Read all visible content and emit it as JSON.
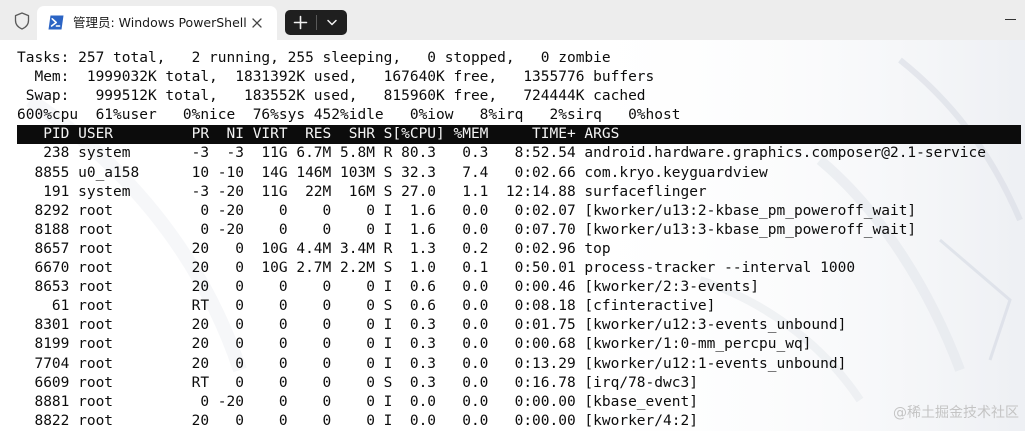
{
  "window": {
    "tab_title": "管理员: Windows PowerShell"
  },
  "icons": {
    "shield": "shield-icon",
    "powershell": "powershell-icon",
    "close": "close-icon",
    "new_tab": "plus-icon",
    "dropdown": "chevron-down-icon",
    "minimize": "minimize-icon"
  },
  "colors": {
    "titlebar_bg": "#ededed",
    "terminal_bg": "#ffffff",
    "terminal_fg": "#0c0c0c",
    "header_bg": "#0c0c0c",
    "header_fg": "#f4f4f4",
    "powershell_blue": "#2b64c4"
  },
  "terminal": {
    "summary": [
      "Tasks: 257 total,   2 running, 255 sleeping,   0 stopped,   0 zombie",
      "  Mem:  1999032K total,  1831392K used,   167640K free,   1355776 buffers",
      " Swap:   999512K total,   183552K used,   815960K free,   724444K cached",
      "600%cpu  61%user   0%nice  76%sys 452%idle   0%iow   8%irq   2%sirq   0%host"
    ],
    "header": "   PID USER         PR  NI VIRT  RES  SHR S[%CPU] %MEM     TIME+ ARGS",
    "processes": [
      "   238 system       -3  -3  11G 6.7M 5.8M R 80.3   0.3   8:52.54 android.hardware.graphics.composer@2.1-service",
      "  8855 u0_a158      10 -10  14G 146M 103M S 32.3   7.4   0:02.66 com.kryo.keyguardview",
      "   191 system       -3 -20  11G  22M  16M S 27.0   1.1  12:14.88 surfaceflinger",
      "  8292 root          0 -20    0    0    0 I  1.6   0.0   0:02.07 [kworker/u13:2-kbase_pm_poweroff_wait]",
      "  8188 root          0 -20    0    0    0 I  1.6   0.0   0:07.70 [kworker/u13:3-kbase_pm_poweroff_wait]",
      "  8657 root         20   0  10G 4.4M 3.4M R  1.3   0.2   0:02.96 top",
      "  6670 root         20   0  10G 2.7M 2.2M S  1.0   0.1   0:50.01 process-tracker --interval 1000",
      "  8653 root         20   0    0    0    0 I  0.6   0.0   0:00.46 [kworker/2:3-events]",
      "    61 root         RT   0    0    0    0 S  0.6   0.0   0:08.18 [cfinteractive]",
      "  8301 root         20   0    0    0    0 I  0.3   0.0   0:01.75 [kworker/u12:3-events_unbound]",
      "  8199 root         20   0    0    0    0 I  0.3   0.0   0:00.68 [kworker/1:0-mm_percpu_wq]",
      "  7704 root         20   0    0    0    0 I  0.3   0.0   0:13.29 [kworker/u12:1-events_unbound]",
      "  6609 root         RT   0    0    0    0 S  0.3   0.0   0:16.78 [irq/78-dwc3]",
      "  8881 root          0 -20    0    0    0 I  0.0   0.0   0:00.00 [kbase_event]",
      "  8822 root         20   0    0    0    0 I  0.0   0.0   0:00.00 [kworker/4:2]"
    ]
  },
  "watermark": "@稀土掘金技术社区"
}
